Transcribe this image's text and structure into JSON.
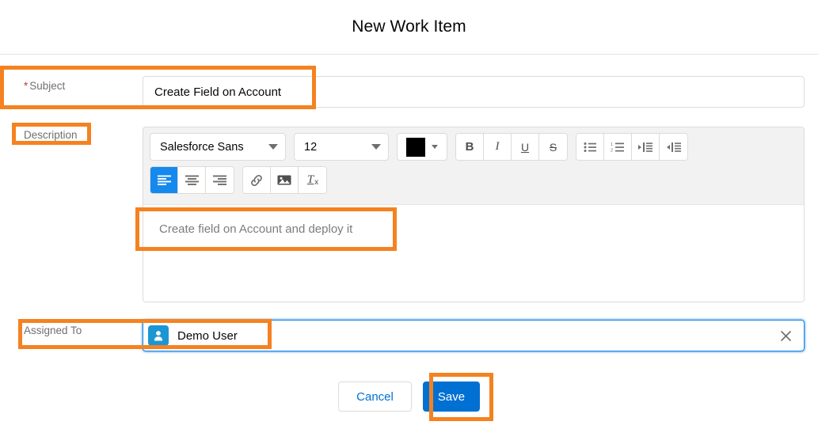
{
  "header": {
    "title": "New Work Item"
  },
  "subject": {
    "label": "Subject",
    "required_marker": "*",
    "value": "Create Field on Account",
    "placeholder": ""
  },
  "description": {
    "label": "Description",
    "body_text": "Create field on Account and deploy it",
    "toolbar": {
      "font_family": "Salesforce Sans",
      "font_size": "12",
      "text_color": "#000000",
      "bold": "B",
      "italic": "I",
      "underline": "U",
      "strikethrough": "S",
      "remove_format": "T",
      "remove_format_sub": "x",
      "active_alignment": "align-left"
    }
  },
  "assigned_to": {
    "label": "Assigned To",
    "selected_name": "Demo User",
    "clear_icon": "×"
  },
  "footer": {
    "cancel_label": "Cancel",
    "save_label": "Save"
  },
  "colors": {
    "accent_blue": "#0070d2",
    "highlight_orange": "#f58220",
    "avatar_blue": "#1b96d4",
    "required_red": "#c23934"
  }
}
